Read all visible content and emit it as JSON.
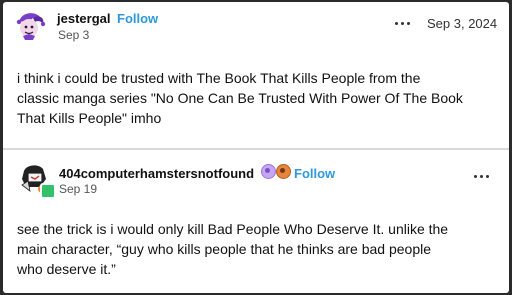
{
  "posts": [
    {
      "username": "jestergal",
      "follow_label": "Follow",
      "sub_date": "Sep 3",
      "post_date": "Sep 3, 2024",
      "avatar_icon": "jester-avatar-icon",
      "body_lines": [
        "i think i could be trusted with The Book That Kills People from the",
        "classic manga series \"No One Can Be Trusted With Power Of The Book",
        "That Kills People\" imho"
      ]
    },
    {
      "username": "404computerhamstersnotfound",
      "follow_label": "Follow",
      "sub_date": "Sep 19",
      "avatar_icon": "hamster-avatar-icon",
      "badge_icons": [
        "purple-badge-icon",
        "orange-badge-icon"
      ],
      "body_lines": [
        "see the trick is i would only kill Bad People Who Deserve It. unlike the",
        "main character, “guy who kills people that he thinks are bad people",
        "who deserve it.”"
      ]
    }
  ],
  "colors": {
    "follow": "#2e9ad8",
    "text": "#111111",
    "background": "#ffffff",
    "frame": "#2b2b2b"
  }
}
